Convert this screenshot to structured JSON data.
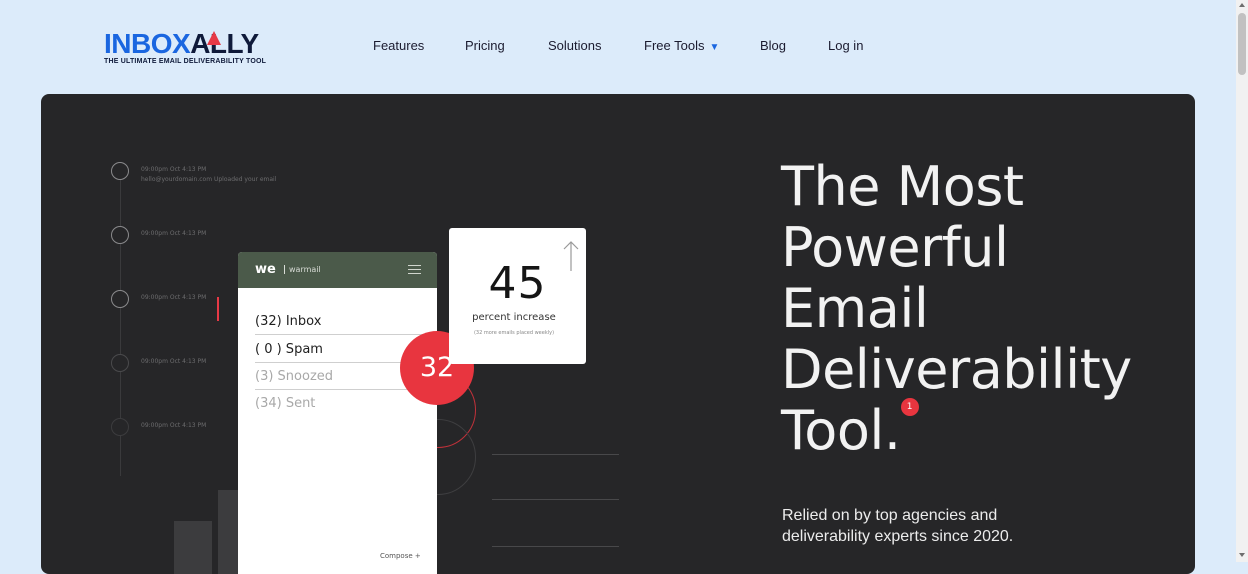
{
  "logo": {
    "part1": "INBOX",
    "part2": "ALLY",
    "tagline": "THE ULTIMATE EMAIL DELIVERABILITY TOOL"
  },
  "nav": {
    "items": [
      "Features",
      "Pricing",
      "Solutions",
      "Free Tools",
      "Blog",
      "Log in"
    ]
  },
  "timeline": {
    "entries": [
      "09:00pm Oct 4:13 PM",
      "hello@yourdomain.com Uploaded your email",
      "09:00pm Oct 4:13 PM",
      "09:00pm Oct 4:13 PM",
      "09:00pm Oct 4:13 PM",
      "09:00pm Oct 4:13 PM"
    ]
  },
  "phone": {
    "brand": "we",
    "brand_sub": "warmail",
    "folders": [
      "(32) Inbox",
      "( 0 ) Spam",
      "(3) Snoozed",
      "(34) Sent"
    ],
    "compose": "Compose"
  },
  "badge": {
    "count": "32"
  },
  "stat": {
    "number": "45",
    "label": "percent increase",
    "sub": "(32 more emails placed weekly)"
  },
  "hero": {
    "title_lines": [
      "The Most",
      "Powerful",
      "Email",
      "Deliverability",
      "Tool."
    ],
    "title_badge": "1",
    "subtitle": "Relied on by top agencies and deliverability experts since 2020."
  },
  "colors": {
    "brand_blue": "#1a66e0",
    "accent_red": "#e8353f",
    "hero_bg": "#262628",
    "page_bg": "#dcebfa"
  }
}
